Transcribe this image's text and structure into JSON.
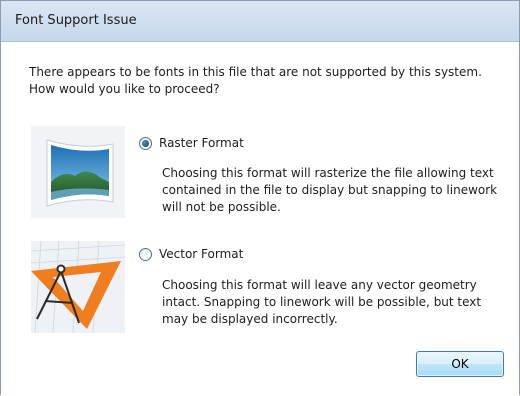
{
  "window": {
    "title": "Font Support Issue"
  },
  "prompt": {
    "line1": "There appears to be fonts in this file that are not supported by this system.",
    "line2": "How would you like to proceed?"
  },
  "options": [
    {
      "label": "Raster Format",
      "selected": true,
      "icon": "landscape-image-icon",
      "description": "Choosing this format will rasterize the file allowing text contained in the file to display but snapping to linework will not be possible."
    },
    {
      "label": "Vector Format",
      "selected": false,
      "icon": "drafting-compass-icon",
      "description": "Choosing this format will leave any vector geometry intact. Snapping to linework will be possible, but text may be displayed incorrectly."
    }
  ],
  "buttons": {
    "ok": "OK"
  },
  "colors": {
    "accent": "#3c7fb1",
    "vector_orange": "#f07d1e"
  }
}
